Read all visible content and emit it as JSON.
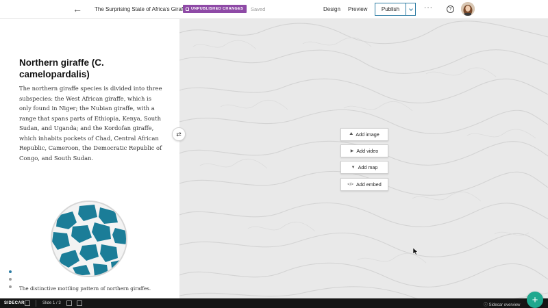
{
  "header": {
    "back_icon": "arrow-left-icon",
    "title": "The Surprising State of Africa's Giraffes",
    "badge": "UNPUBLISHED CHANGES",
    "saved": "Saved",
    "design": "Design",
    "preview": "Preview",
    "publish": "Publish",
    "more": "···",
    "help": "?"
  },
  "narrative": {
    "heading": "Northern giraffe (C. camelopardalis)",
    "body": "The northern giraffe species is divided into three subspecies: the West African giraffe, which is only found in Niger; the Nubian giraffe, with a range that spans parts of Ethiopia, Kenya, South Sudan, and Uganda; and the Kordofan giraffe, which inhabits pockets of Chad, Central African Republic, Cameroon, the Democratic Republic of Congo, and South Sudan.",
    "caption": "The distinctive mottling pattern of northern giraffes."
  },
  "swap_icon": "⇄",
  "stage": {
    "add_image": "Add image",
    "add_video": "Add video",
    "add_map": "Add map",
    "add_embed": "Add embed"
  },
  "bottom_bar": {
    "sidecar": "SIDECAR",
    "slide": "Slide 1 / 3",
    "overview": "Sidecar overview"
  },
  "fab_label": "+",
  "colors": {
    "accent": "#2b7ba3",
    "badge": "#8e4aa6",
    "fab": "#1fa88e",
    "giraffe_pattern": "#1b7d98"
  }
}
